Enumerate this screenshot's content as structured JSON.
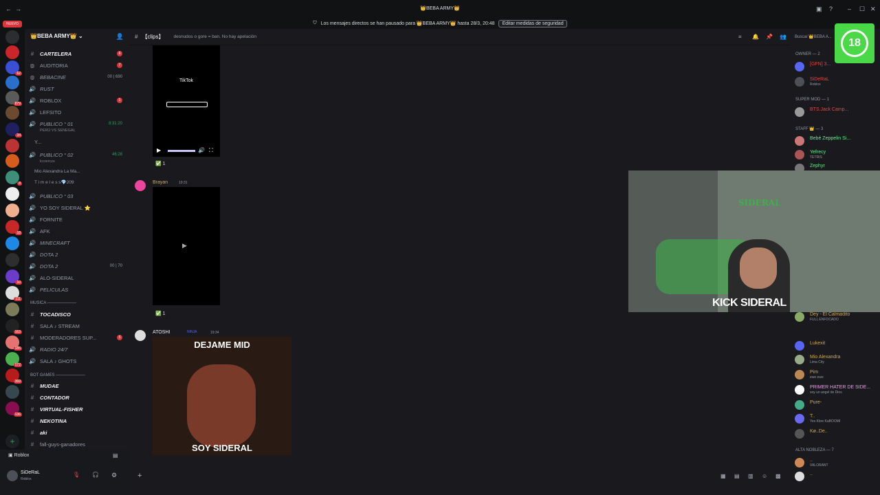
{
  "titlebar": {
    "title": "👑BEBA ARMY👑"
  },
  "notice": {
    "text": "Los mensajes directos se han pausado para 👑BEBA ARMY👑 hasta 28/3, 20:48",
    "button": "Editar medidas de seguridad"
  },
  "rail": {
    "nuevo_badge": "NUEVO",
    "badges": [
      "2",
      "5",
      "62",
      "879",
      "34",
      "8",
      "5",
      "18",
      "33",
      "111",
      "822",
      "10",
      "163",
      "185",
      "172",
      "369",
      "136"
    ]
  },
  "server": {
    "name": "👑BEBA ARMY👑"
  },
  "channels": [
    {
      "label": "CARTELERA",
      "bold": true,
      "badge": "6"
    },
    {
      "label": "AUDITORIA",
      "badge": "7"
    },
    {
      "label": "BEBACINE",
      "extra": "00 | 690"
    },
    {
      "label": "RUST"
    },
    {
      "label": "ROBLOX",
      "badge": "1"
    },
    {
      "label": "LEFSITO"
    },
    {
      "label": "PUBLICO ° 01",
      "right": "8:31:20",
      "sub": "PERÚ VS SENEGAL"
    },
    {
      "label": "Y..."
    },
    {
      "label": "PUBLICO ° 02",
      "right": "46:28",
      "sub": "lccrerczs"
    },
    {
      "label": "Mio Alexandra La Ma..."
    },
    {
      "label": "T i m e l e s s💎209"
    },
    {
      "label": "PUBLICO ° 03"
    },
    {
      "label": "YO SOY SIDERAL ⭐"
    },
    {
      "label": "FORNITE"
    },
    {
      "label": "AFK"
    },
    {
      "label": "MINECRAFT"
    },
    {
      "label": "DOTA 2"
    },
    {
      "label": "DOTA 2",
      "extra": "00 | 70"
    },
    {
      "label": "ALO-SIDERAL"
    },
    {
      "label": "PELICULAS"
    }
  ],
  "cat_musica": "MUSICA ──────────",
  "music_channels": [
    {
      "label": "TOCADISCO",
      "bold": true
    },
    {
      "label": "SALA ♪ STREAM"
    },
    {
      "label": "MODERADORES SUP...",
      "badge": "5"
    },
    {
      "label": "RADIO 24/7"
    },
    {
      "label": "SALA ♪ GHOTS"
    }
  ],
  "cat_bots": "BOT GAMES ──────────",
  "bot_channels": [
    {
      "label": "MUDAE",
      "bold": true
    },
    {
      "label": "CONTADOR",
      "bold": true
    },
    {
      "label": "VIRTUAL-FISHER",
      "bold": true
    },
    {
      "label": "NEKOTINA",
      "bold": true
    },
    {
      "label": "aki",
      "bold": true
    },
    {
      "label": "fall-guys-ganadores"
    }
  ],
  "activity": {
    "label": "Roblox"
  },
  "user": {
    "name": "SiDeRaL",
    "status": "Roblox"
  },
  "header": {
    "channel": "【clips】",
    "topic": "desnudos o gore = ban. No hay apelación",
    "search": "Buscar 👑BEBA A..."
  },
  "messages": [
    {
      "tiktok_label": "TikTok",
      "reaction": "1"
    },
    {
      "author": "Brayan",
      "time": "19:31",
      "reaction": "1"
    },
    {
      "author": "ATOSHI",
      "tag": "NINJA",
      "time": "19:34",
      "meme_top": "DEJAME MID",
      "meme_bottom": "SOY SIDERAL"
    }
  ],
  "members": {
    "roles": [
      "OWNER — 2",
      "SUPER MOD — 1",
      "STAFF 👑 — 3",
      "ALTA NOBLEZA — 7"
    ],
    "list": [
      {
        "name": "[GFN] 3...",
        "sub": "",
        "color": "#f23f43"
      },
      {
        "name": "SiDeRaL",
        "sub": "Roblox",
        "color": "#f23f43"
      },
      {
        "name": "BTS.Jack Camp...",
        "sub": "",
        "color": "#f23f43"
      },
      {
        "name": "Bebé Zeppelin Si...",
        "sub": "",
        "color": "#57f287"
      },
      {
        "name": "Yefrecy",
        "sub": "TETRIS",
        "color": "#57f287"
      },
      {
        "name": "Zephyr",
        "sub": "",
        "color": "#57f287"
      },
      {
        "name": "Dey - El Calmadito",
        "sub": "FULL ENFOCADO",
        "color": "#cfa84a"
      },
      {
        "name": "Lukexit",
        "sub": "",
        "color": "#cfa84a"
      },
      {
        "name": "Mio Alexandra",
        "sub": "Lima City",
        "color": "#cfa84a"
      },
      {
        "name": "Pim",
        "sub": "ewe ewe",
        "color": "#cfa84a"
      },
      {
        "name": "PRIMER HATER DE SIDE...",
        "sub": "soy un angel de Dios",
        "color": "#e0a0e0"
      },
      {
        "name": "Pure-",
        "sub": "",
        "color": "#cfa84a"
      },
      {
        "name": "T..",
        "sub": "Yes Kbre KaBOOMI",
        "color": "#cfa84a"
      },
      {
        "name": "Kø..De..",
        "sub": "",
        "color": "#cfa84a"
      },
      {
        "name": "..",
        "sub": "VALORANT",
        "color": "#cfa84a"
      },
      {
        "name": "..",
        "sub": "",
        "color": "#cfa84a"
      }
    ]
  },
  "camera": {
    "overlay_text": "KICK SIDERAL",
    "wall_text": "SIDERAL"
  },
  "rating_badge": "18"
}
